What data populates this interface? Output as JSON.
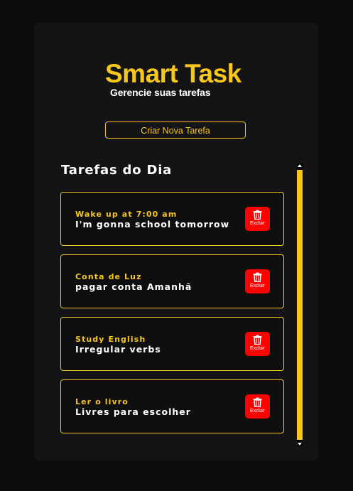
{
  "app": {
    "title": "Smart Task",
    "subtitle": "Gerencie suas tarefas"
  },
  "actions": {
    "create_label": "Criar Nova Tarefa"
  },
  "section": {
    "title": "Tarefas do Dia"
  },
  "tasks": [
    {
      "title": "Wake up at 7:00 am",
      "description": "I'm gonna school tomorrow",
      "delete_label": "Excluir",
      "icon": "trash-icon"
    },
    {
      "title": "Conta de Luz",
      "description": "pagar conta Amanhã",
      "delete_label": "Excluir",
      "icon": "trash-icon"
    },
    {
      "title": "Study English",
      "description": "Irregular verbs",
      "delete_label": "Excluir",
      "icon": "trash-icon"
    },
    {
      "title": "Ler o livro",
      "description": "Livres para escolher",
      "delete_label": "Excluir",
      "icon": "trash-icon"
    }
  ],
  "colors": {
    "accent": "#f7c71c",
    "danger": "#ff0000",
    "background": "#0b0b0c",
    "card": "#141416"
  }
}
